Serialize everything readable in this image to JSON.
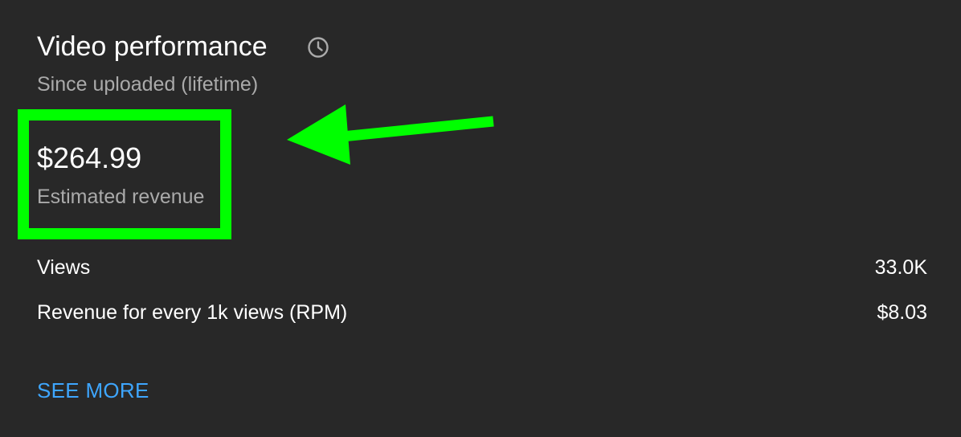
{
  "card": {
    "title": "Video performance",
    "subtitle": "Since uploaded (lifetime)",
    "title_icon": "clock-icon"
  },
  "revenue": {
    "value": "$264.99",
    "label": "Estimated revenue"
  },
  "metrics": [
    {
      "label": "Views",
      "value": "33.0K"
    },
    {
      "label": "Revenue for every 1k views (RPM)",
      "value": "$8.03"
    }
  ],
  "see_more": "SEE MORE",
  "annotation": {
    "color": "#00ff00",
    "shapes": [
      "highlight-box",
      "arrow-icon"
    ]
  },
  "colors": {
    "background": "#282828",
    "primary_text": "#ffffff",
    "secondary_text": "#aaaaaa",
    "link": "#3ea6ff"
  }
}
